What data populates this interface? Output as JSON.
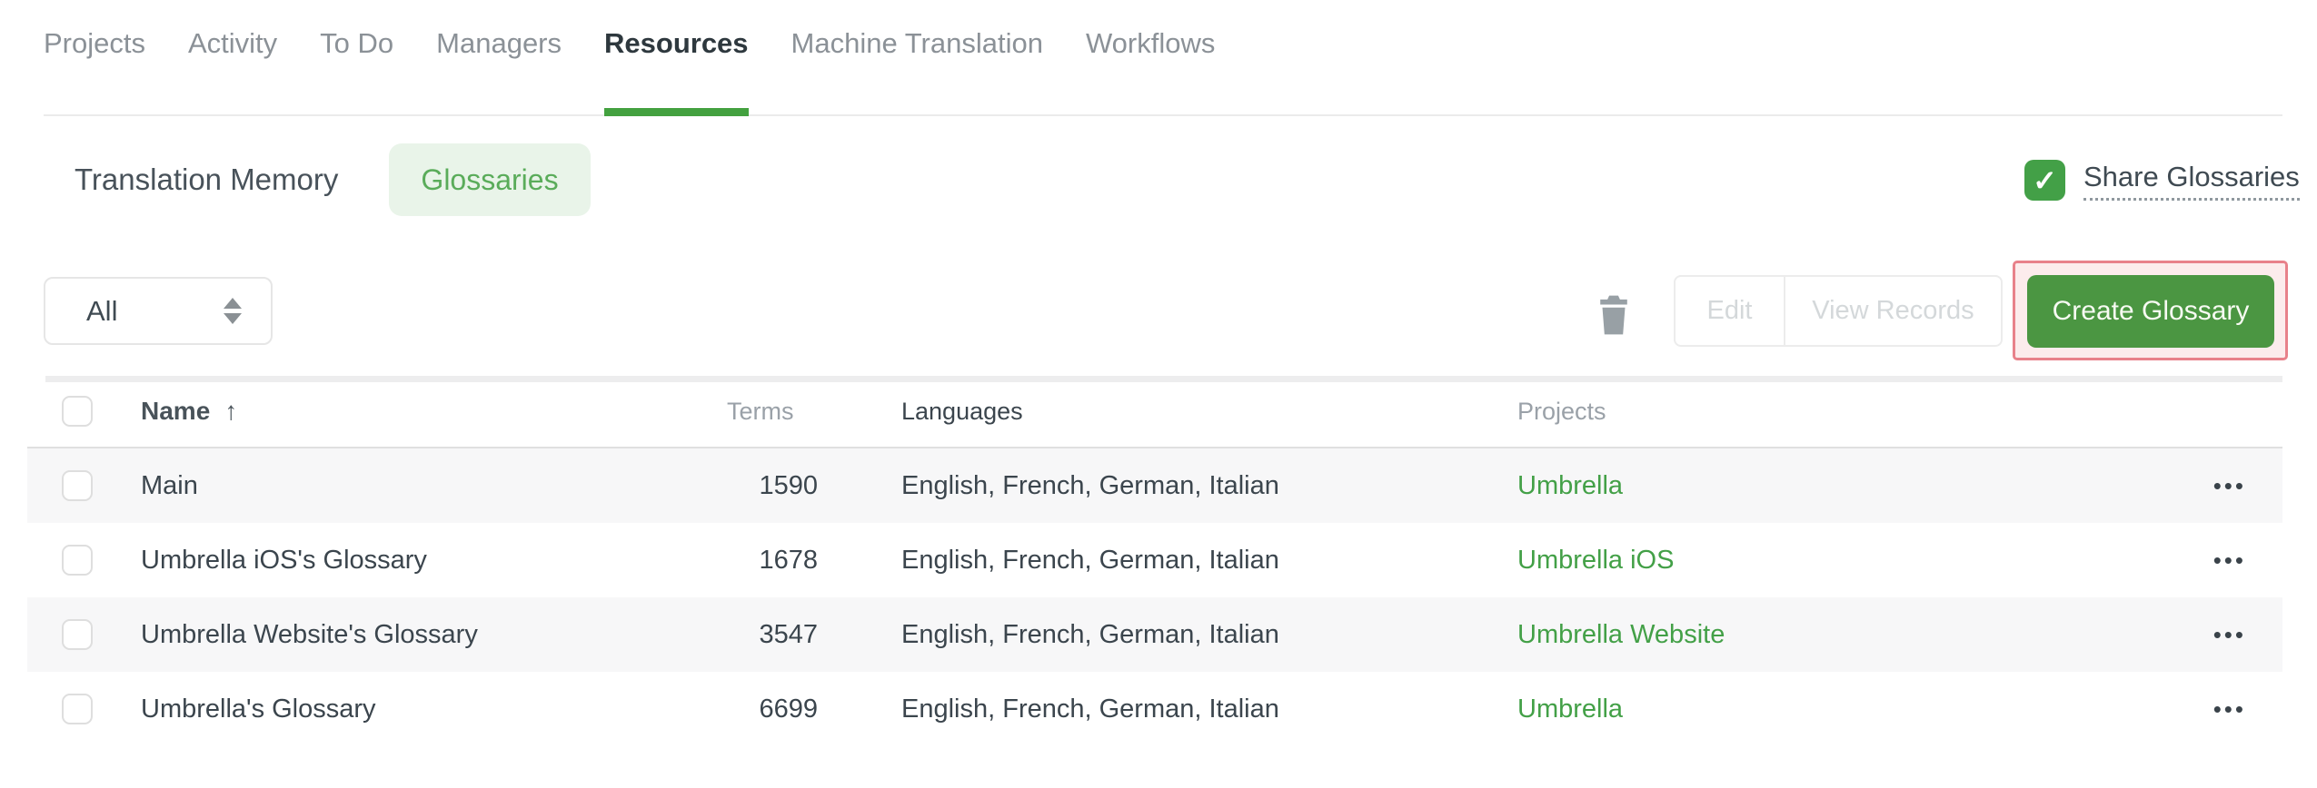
{
  "nav": {
    "active_tab": "Resources",
    "tabs": [
      {
        "label": "Projects"
      },
      {
        "label": "Activity"
      },
      {
        "label": "To Do"
      },
      {
        "label": "Managers"
      },
      {
        "label": "Resources"
      },
      {
        "label": "Machine Translation"
      },
      {
        "label": "Workflows"
      }
    ]
  },
  "subnav": {
    "translation_memory_label": "Translation Memory",
    "glossaries_label": "Glossaries",
    "share_glossaries_label": "Share Glossaries",
    "share_glossaries_checked": true
  },
  "toolbar": {
    "filter_selected": "All",
    "edit_label": "Edit",
    "view_records_label": "View Records",
    "create_glossary_label": "Create Glossary",
    "edit_enabled": false,
    "view_records_enabled": false
  },
  "table": {
    "headers": {
      "name": "Name",
      "terms": "Terms",
      "languages": "Languages",
      "projects": "Projects"
    },
    "sort": {
      "column": "Name",
      "direction": "ascending"
    },
    "rows": [
      {
        "name": "Main",
        "terms": "1590",
        "languages": "English, French, German, Italian",
        "project": "Umbrella"
      },
      {
        "name": "Umbrella iOS's Glossary",
        "terms": "1678",
        "languages": "English, French, German, Italian",
        "project": "Umbrella iOS"
      },
      {
        "name": "Umbrella Website's Glossary",
        "terms": "3547",
        "languages": "English, French, German, Italian",
        "project": "Umbrella Website"
      },
      {
        "name": "Umbrella's Glossary",
        "terms": "6699",
        "languages": "English, French, German, Italian",
        "project": "Umbrella"
      }
    ]
  },
  "icons": {
    "check": "✓",
    "sort_asc": "↑",
    "more": "•••"
  },
  "colors": {
    "accent_green": "#43a047",
    "button_green": "#4b9642",
    "tab_underline_green": "#43a13f",
    "pill_bg": "#e9f4e9",
    "pill_text": "#5aac5a",
    "highlight_border": "#e8818a",
    "highlight_bg": "#fcecec",
    "row_stripe": "#f7f7f8"
  }
}
